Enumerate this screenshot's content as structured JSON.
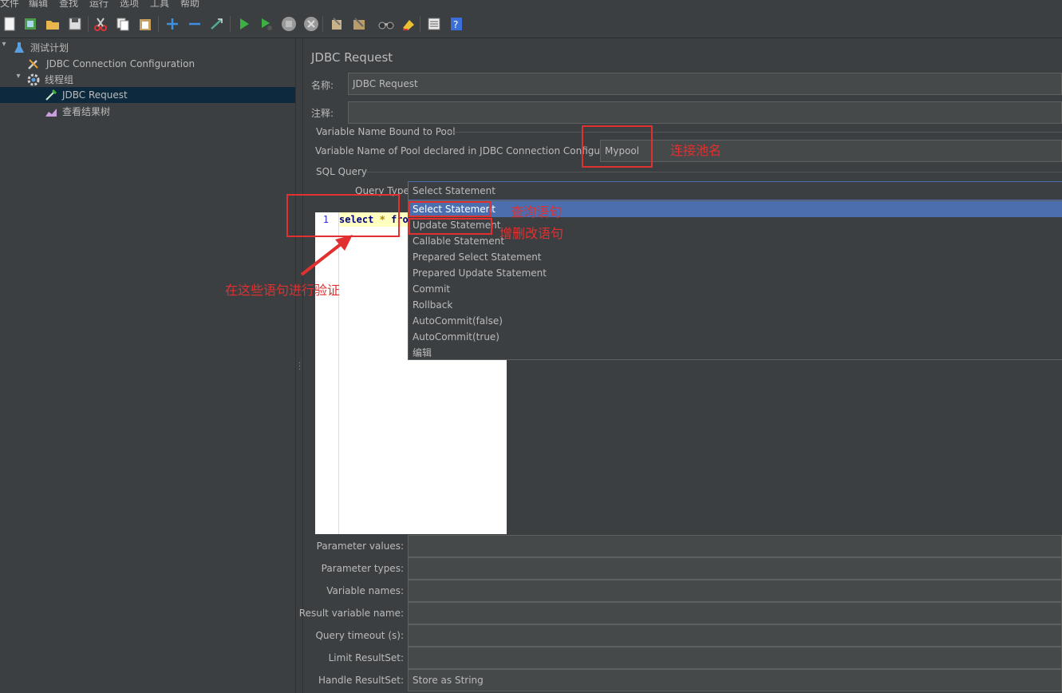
{
  "menu": [
    "文件",
    "编辑",
    "查找",
    "运行",
    "选项",
    "工具",
    "帮助"
  ],
  "toolbar_icons": [
    "new-icon",
    "templates-icon",
    "open-icon",
    "save-icon",
    "cut-icon",
    "copy-icon",
    "paste-icon",
    "expand-icon",
    "collapse-icon",
    "toggle-icon",
    "start-icon",
    "start-no-pause-icon",
    "stop-icon",
    "shutdown-icon",
    "clear-icon",
    "clear-all-icon",
    "search-icon",
    "reset-search-icon",
    "function-helper-icon",
    "help-icon"
  ],
  "tree": {
    "items": [
      {
        "label": "测试计划",
        "icon": "flask-icon"
      },
      {
        "label": "JDBC Connection Configuration",
        "icon": "wrench-icon"
      },
      {
        "label": "线程组",
        "icon": "gear-icon"
      },
      {
        "label": "JDBC Request",
        "icon": "pipette-icon"
      },
      {
        "label": "查看结果树",
        "icon": "chart-icon"
      }
    ]
  },
  "panel": {
    "title": "JDBC Request",
    "name_label": "名称:",
    "name_value": "JDBC Request",
    "comment_label": "注释:",
    "comment_value": "",
    "pool_group": "Variable Name Bound to Pool",
    "pool_label": "Variable Name of Pool declared in JDBC Connection Configuration:",
    "pool_value": "Mypool",
    "sql_group": "SQL Query",
    "query_type_label": "Query Type:",
    "query_type_value": "Select Statement",
    "code_line_number": "1",
    "code_kw1": "select",
    "code_op": "*",
    "code_kw2": "fro",
    "options": [
      "Select Statement",
      "Update Statement",
      "Callable Statement",
      "Prepared Select Statement",
      "Prepared Update Statement",
      "Commit",
      "Rollback",
      "AutoCommit(false)",
      "AutoCommit(true)",
      "编辑"
    ],
    "params": [
      {
        "label": "Parameter values:",
        "value": ""
      },
      {
        "label": "Parameter types:",
        "value": ""
      },
      {
        "label": "Variable names:",
        "value": ""
      },
      {
        "label": "Result variable name:",
        "value": ""
      },
      {
        "label": "Query timeout (s):",
        "value": ""
      },
      {
        "label": "Limit ResultSet:",
        "value": ""
      },
      {
        "label": "Handle ResultSet:",
        "value": "Store as String"
      }
    ]
  },
  "annotations": {
    "pool_note": "连接池名",
    "select_note": "查询语句",
    "update_note": "增删改语句",
    "verify_note": "在这些语句进行验证"
  },
  "colors": {
    "annotation": "#e03030",
    "selection": "#4b6eaf",
    "tree_selection": "#0d293e"
  }
}
